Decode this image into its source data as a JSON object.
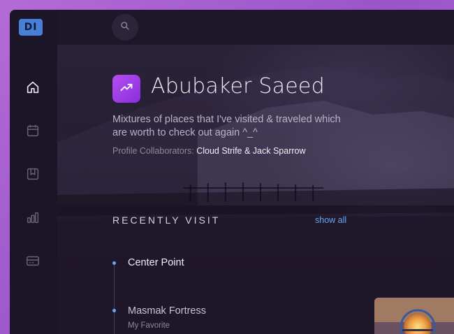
{
  "app": {
    "logo_text": "DI"
  },
  "sidebar": {
    "items": [
      {
        "icon": "home-icon",
        "active": true
      },
      {
        "icon": "calendar-icon",
        "active": false
      },
      {
        "icon": "bookmark-icon",
        "active": false
      },
      {
        "icon": "bar-chart-icon",
        "active": false
      },
      {
        "icon": "credit-card-icon",
        "active": false
      }
    ]
  },
  "topbar": {
    "search_icon": "search-icon"
  },
  "profile": {
    "badge_icon": "trending-up-icon",
    "name": "Abubaker Saeed",
    "description": "Mixtures of places that I've visited & traveled which are worth to check out again ^_^",
    "collaborators_label": "Profile Collaborators:",
    "collaborators": "Cloud Strife & Jack Sparrow"
  },
  "recent": {
    "title": "RECENTLY VISIT",
    "show_all_label": "show all",
    "places": [
      {
        "name": "Center Point",
        "subtitle": ""
      },
      {
        "name": "Masmak Fortress",
        "subtitle": "My Favorite"
      }
    ]
  },
  "colors": {
    "accent": "#6aa6f0",
    "badge": "#a63ee8",
    "logo": "#4a7fd9",
    "background": "#1e1729"
  }
}
